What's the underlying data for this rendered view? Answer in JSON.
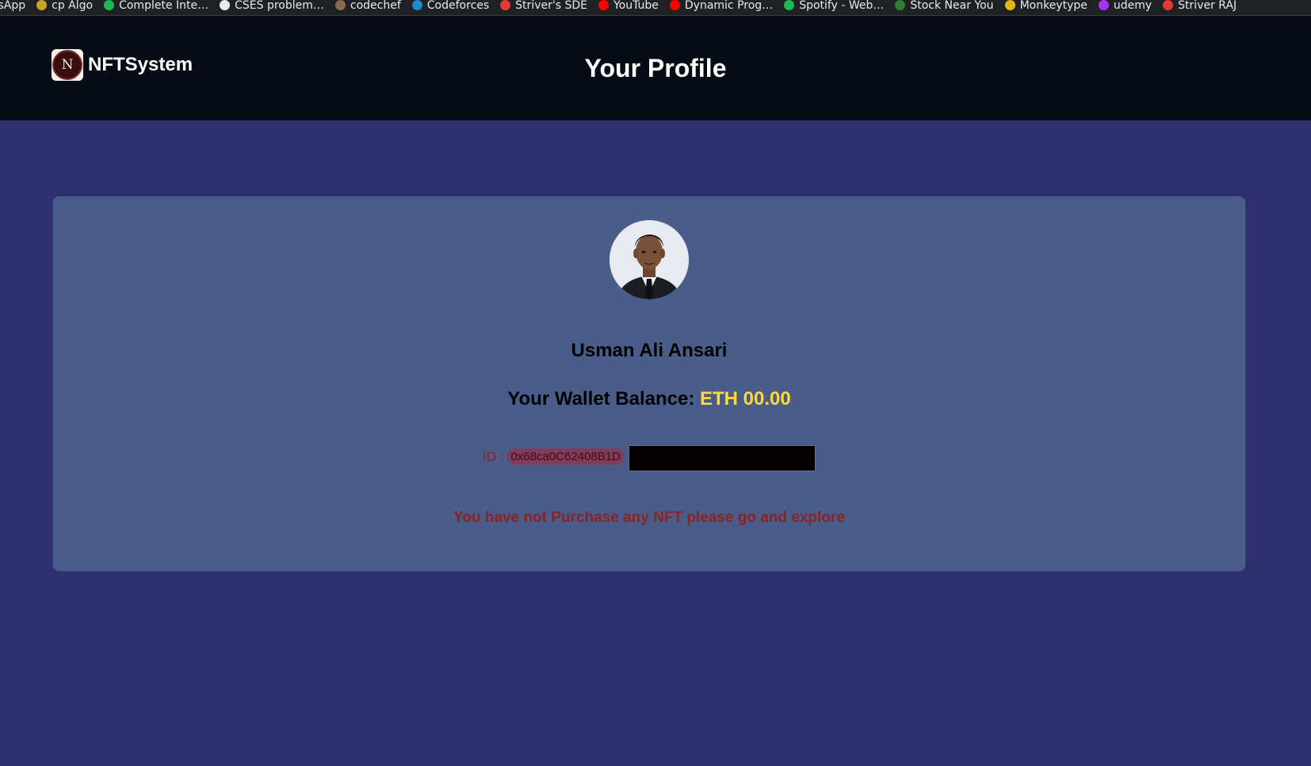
{
  "bookmarks": [
    {
      "label": "tsApp",
      "icon": "whatsapp-icon",
      "color": "#25d366"
    },
    {
      "label": "cp Algo",
      "icon": "cp-algo-icon",
      "color": "#c9a227"
    },
    {
      "label": "Complete Inte…",
      "icon": "link-icon",
      "color": "#1db954"
    },
    {
      "label": "CSES problem…",
      "icon": "globe-icon",
      "color": "#e8eaed"
    },
    {
      "label": "codechef",
      "icon": "codechef-icon",
      "color": "#8b6a4e"
    },
    {
      "label": "Codeforces",
      "icon": "codeforces-icon",
      "color": "#1f8acb"
    },
    {
      "label": "Striver's SDE",
      "icon": "takeuforward-icon",
      "color": "#e53935"
    },
    {
      "label": "YouTube",
      "icon": "youtube-icon",
      "color": "#ff0000"
    },
    {
      "label": "Dynamic Prog…",
      "icon": "youtube-icon",
      "color": "#ff0000"
    },
    {
      "label": "Spotify - Web…",
      "icon": "spotify-icon",
      "color": "#1db954"
    },
    {
      "label": "Stock Near You",
      "icon": "stock-icon",
      "color": "#2e7d32"
    },
    {
      "label": "Monkeytype",
      "icon": "monkeytype-icon",
      "color": "#e2b714"
    },
    {
      "label": "udemy",
      "icon": "udemy-icon",
      "color": "#a435f0"
    },
    {
      "label": "Striver RAJ",
      "icon": "takeuforward-icon",
      "color": "#e53935"
    }
  ],
  "header": {
    "brand_logo_text": "N",
    "brand_name": "NFTSystem",
    "page_title": "Your Profile"
  },
  "profile": {
    "user_name": "Usman Ali Ansari",
    "balance_label": "Your Wallet Balance:",
    "balance_amount": "ETH 00.00",
    "id_label": "ID :",
    "wallet_address_visible": "0x68ca0C62408B1D",
    "empty_message": "You have not Purchase any NFT please go and explore"
  },
  "colors": {
    "page_bg": "#2e2f6e",
    "header_bg": "#070b16",
    "card_bg": "#4a5c8a",
    "balance_accent": "#ffd93a",
    "message_red": "#8b2323"
  }
}
